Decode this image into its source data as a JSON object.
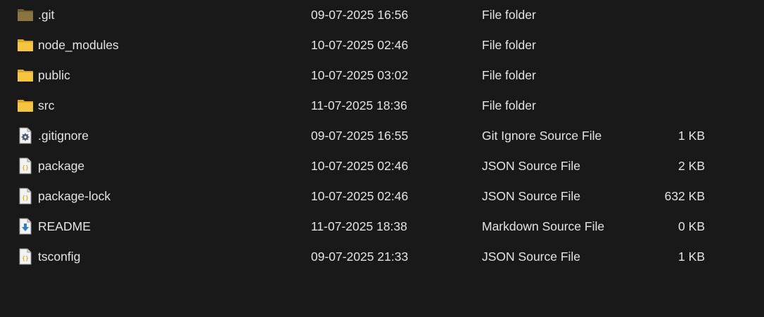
{
  "files": [
    {
      "name": ".git",
      "date": "09-07-2025 16:56",
      "type": "File folder",
      "size": "",
      "icon": "folder-dimmed-icon"
    },
    {
      "name": "node_modules",
      "date": "10-07-2025 02:46",
      "type": "File folder",
      "size": "",
      "icon": "folder-icon"
    },
    {
      "name": "public",
      "date": "10-07-2025 03:02",
      "type": "File folder",
      "size": "",
      "icon": "folder-icon"
    },
    {
      "name": "src",
      "date": "11-07-2025 18:36",
      "type": "File folder",
      "size": "",
      "icon": "folder-icon"
    },
    {
      "name": ".gitignore",
      "date": "09-07-2025 16:55",
      "type": "Git Ignore Source File",
      "size": "1 KB",
      "icon": "gear-file-icon"
    },
    {
      "name": "package",
      "date": "10-07-2025 02:46",
      "type": "JSON Source File",
      "size": "2 KB",
      "icon": "json-file-icon"
    },
    {
      "name": "package-lock",
      "date": "10-07-2025 02:46",
      "type": "JSON Source File",
      "size": "632 KB",
      "icon": "json-file-icon"
    },
    {
      "name": "README",
      "date": "11-07-2025 18:38",
      "type": "Markdown Source File",
      "size": "0 KB",
      "icon": "markdown-file-icon"
    },
    {
      "name": "tsconfig",
      "date": "09-07-2025 21:33",
      "type": "JSON Source File",
      "size": "1 KB",
      "icon": "json-file-icon"
    }
  ],
  "colors": {
    "background": "#191919",
    "text": "#e4e4e4",
    "folder": "#f5c542",
    "folder_dimmed": "#8a7440",
    "json_brace": "#d4b02a",
    "markdown_arrow": "#2f7fc2"
  }
}
